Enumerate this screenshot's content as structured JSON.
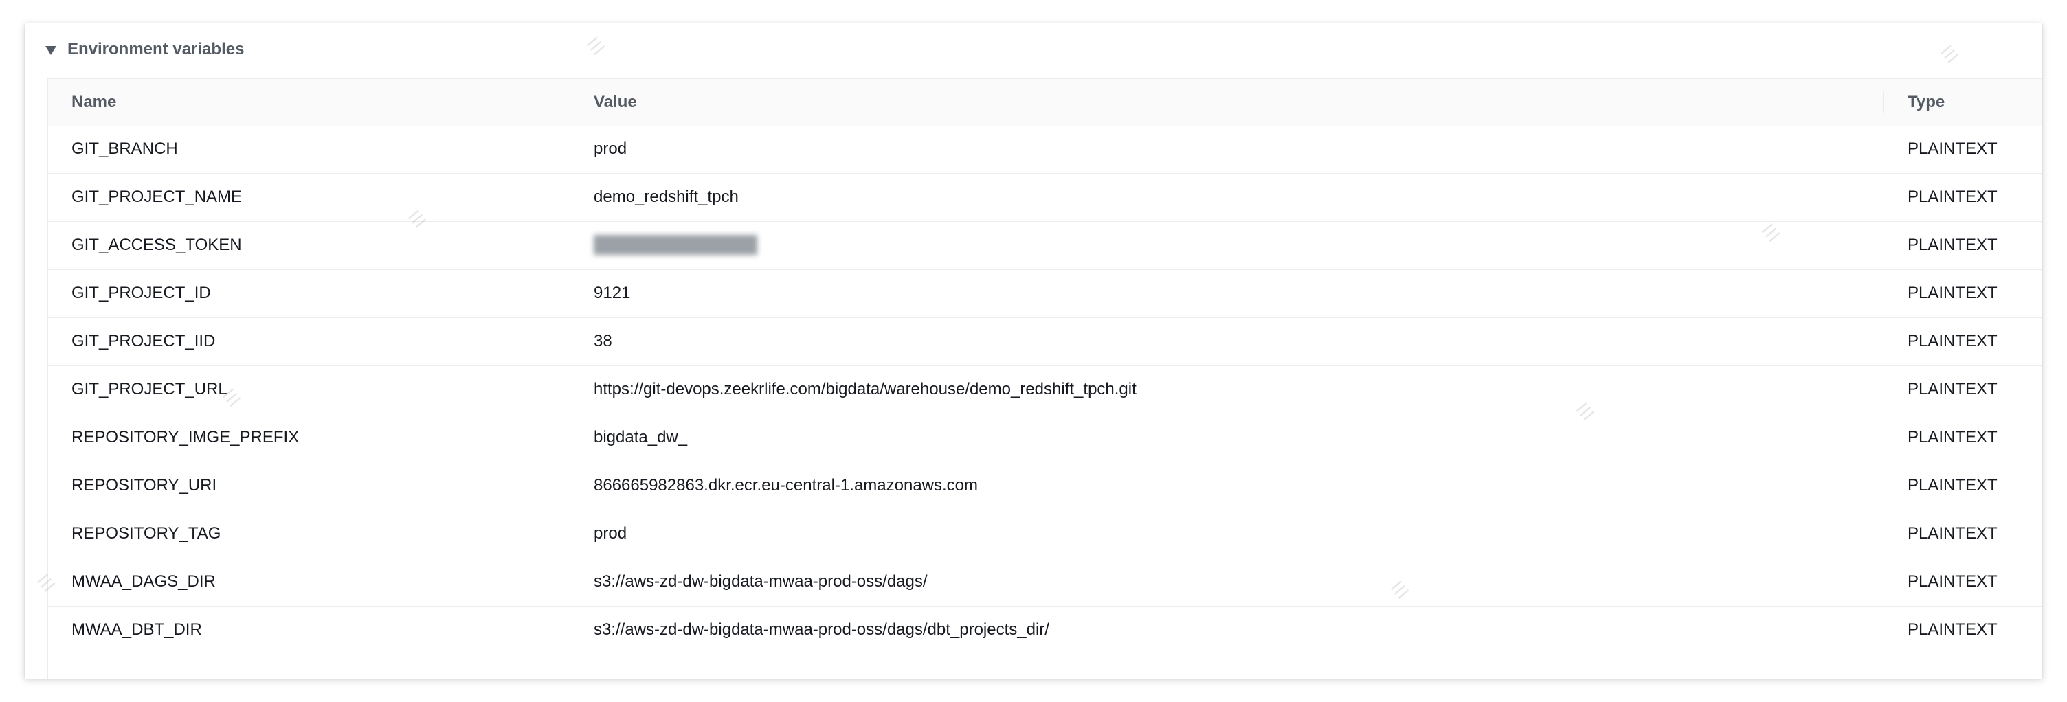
{
  "section": {
    "title": "Environment variables"
  },
  "table": {
    "columns": [
      "Name",
      "Value",
      "Type"
    ],
    "rows": [
      {
        "name": "GIT_BRANCH",
        "value": "prod",
        "type": "PLAINTEXT"
      },
      {
        "name": "GIT_PROJECT_NAME",
        "value": "demo_redshift_tpch",
        "type": "PLAINTEXT"
      },
      {
        "name": "GIT_ACCESS_TOKEN",
        "value": "",
        "type": "PLAINTEXT"
      },
      {
        "name": "GIT_PROJECT_ID",
        "value": "9121",
        "type": "PLAINTEXT"
      },
      {
        "name": "GIT_PROJECT_IID",
        "value": "38",
        "type": "PLAINTEXT"
      },
      {
        "name": "GIT_PROJECT_URL",
        "value": "https://git-devops.zeekrlife.com/bigdata/warehouse/demo_redshift_tpch.git",
        "type": "PLAINTEXT"
      },
      {
        "name": "REPOSITORY_IMGE_PREFIX",
        "value": "bigdata_dw_",
        "type": "PLAINTEXT"
      },
      {
        "name": "REPOSITORY_URI",
        "value": "866665982863.dkr.ecr.eu-central-1.amazonaws.com",
        "type": "PLAINTEXT"
      },
      {
        "name": "REPOSITORY_TAG",
        "value": "prod",
        "type": "PLAINTEXT"
      },
      {
        "name": "MWAA_DAGS_DIR",
        "value": "s3://aws-zd-dw-bigdata-mwaa-prod-oss/dags/",
        "type": "PLAINTEXT"
      },
      {
        "name": "MWAA_DBT_DIR",
        "value": "s3://aws-zd-dw-bigdata-mwaa-prod-oss/dags/dbt_projects_dir/",
        "type": "PLAINTEXT"
      }
    ]
  },
  "icons": {
    "section_toggle": "caret-down-icon"
  }
}
